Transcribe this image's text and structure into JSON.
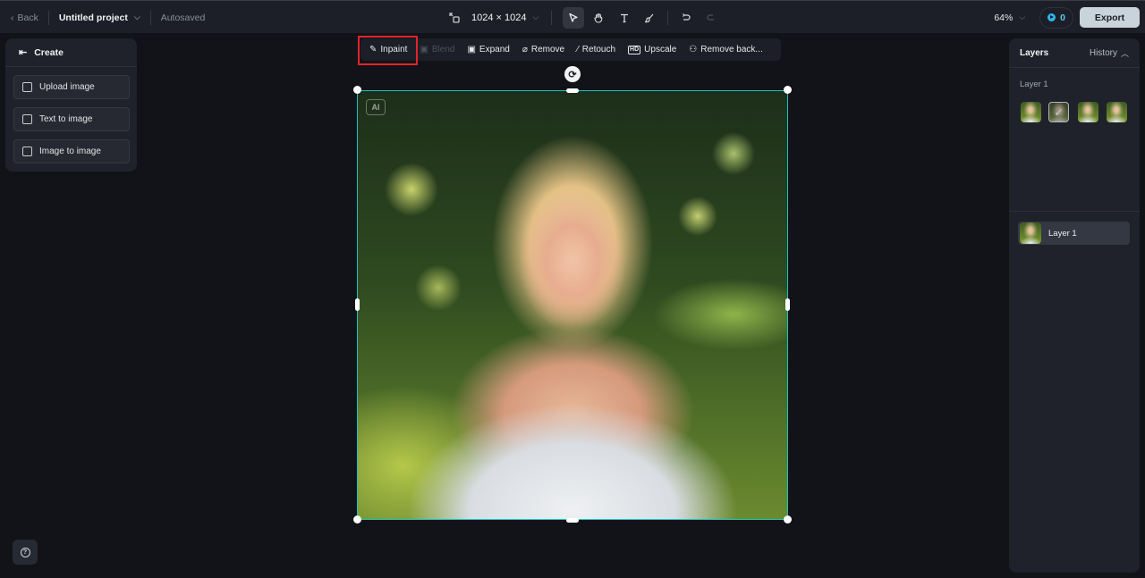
{
  "topbar": {
    "back_label": "Back",
    "project_name": "Untitled project",
    "save_status": "Autosaved",
    "canvas_size": "1024 × 1024",
    "zoom_level": "64%",
    "credits": "0",
    "export_label": "Export",
    "tools": [
      {
        "name": "select",
        "icon": "cursor-arrow-icon",
        "active": true
      },
      {
        "name": "hand",
        "icon": "hand-icon",
        "active": false
      },
      {
        "name": "text",
        "icon": "text-icon",
        "active": false
      },
      {
        "name": "brush",
        "icon": "brush-icon",
        "active": false
      },
      {
        "name": "undo",
        "icon": "undo-icon",
        "active": false
      },
      {
        "name": "redo",
        "icon": "redo-icon",
        "active": false
      }
    ]
  },
  "left_panel": {
    "title": "Create",
    "items": [
      {
        "label": "Upload image",
        "icon": "upload-image-icon"
      },
      {
        "label": "Text to image",
        "icon": "text-to-image-icon"
      },
      {
        "label": "Image to image",
        "icon": "image-to-image-icon"
      }
    ]
  },
  "context_toolbar": {
    "items": [
      {
        "label": "Inpaint",
        "icon": "inpaint-icon",
        "enabled": true,
        "highlighted": true
      },
      {
        "label": "Blend",
        "icon": "blend-icon",
        "enabled": false
      },
      {
        "label": "Expand",
        "icon": "expand-icon",
        "enabled": true
      },
      {
        "label": "Remove",
        "icon": "eraser-icon",
        "enabled": true
      },
      {
        "label": "Retouch",
        "icon": "magic-wand-icon",
        "enabled": true
      },
      {
        "label": "Upscale",
        "icon": "hd-icon",
        "icon_text": "HD",
        "enabled": true
      },
      {
        "label": "Remove back...",
        "icon": "remove-background-icon",
        "enabled": true
      }
    ]
  },
  "canvas": {
    "ai_badge": "AI",
    "image_description": "Portrait of a blonde woman in white halter top with bokeh green background"
  },
  "right_panel": {
    "title": "Layers",
    "history_label": "History",
    "variant_group_label": "Layer 1",
    "variants_count": 4,
    "selected_variant": 2,
    "layers": [
      {
        "label": "Layer 1"
      }
    ]
  }
}
